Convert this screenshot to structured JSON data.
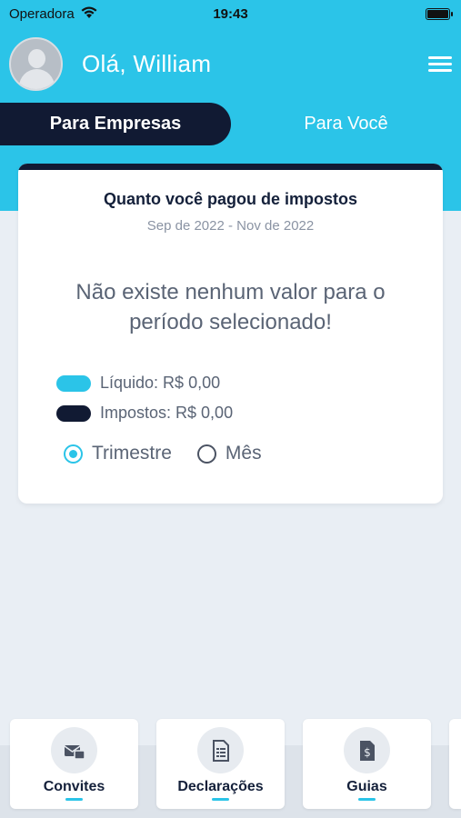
{
  "status_bar": {
    "carrier": "Operadora",
    "time": "19:43",
    "wifi_icon": "wifi-icon",
    "battery_icon": "battery-icon",
    "battery_level": 1.0
  },
  "header": {
    "greeting": "Olá, William",
    "avatar_icon": "user-avatar-icon",
    "menu_icon": "hamburger-menu-icon"
  },
  "tabs": [
    {
      "label": "Para Empresas",
      "active": true
    },
    {
      "label": "Para Você",
      "active": false
    }
  ],
  "card": {
    "title": "Quanto você pagou de impostos",
    "range": "Sep de 2022 - Nov de 2022",
    "empty_message": "Não existe nenhum valor para o período selecionado!",
    "legend": [
      {
        "label": "Líquido: R$ 0,00",
        "color": "#2bc4e8"
      },
      {
        "label": "Impostos: R$ 0,00",
        "color": "#111a33"
      }
    ],
    "period_options": [
      {
        "label": "Trimestre",
        "selected": true
      },
      {
        "label": "Mês",
        "selected": false
      }
    ]
  },
  "shortcuts": [
    {
      "label": "Convites",
      "icon": "invite-icon"
    },
    {
      "label": "Declarações",
      "icon": "document-icon"
    },
    {
      "label": "Guias",
      "icon": "payment-slip-icon"
    }
  ],
  "colors": {
    "accent": "#2bc4e8",
    "dark": "#111a33",
    "background": "#e9eef4"
  }
}
